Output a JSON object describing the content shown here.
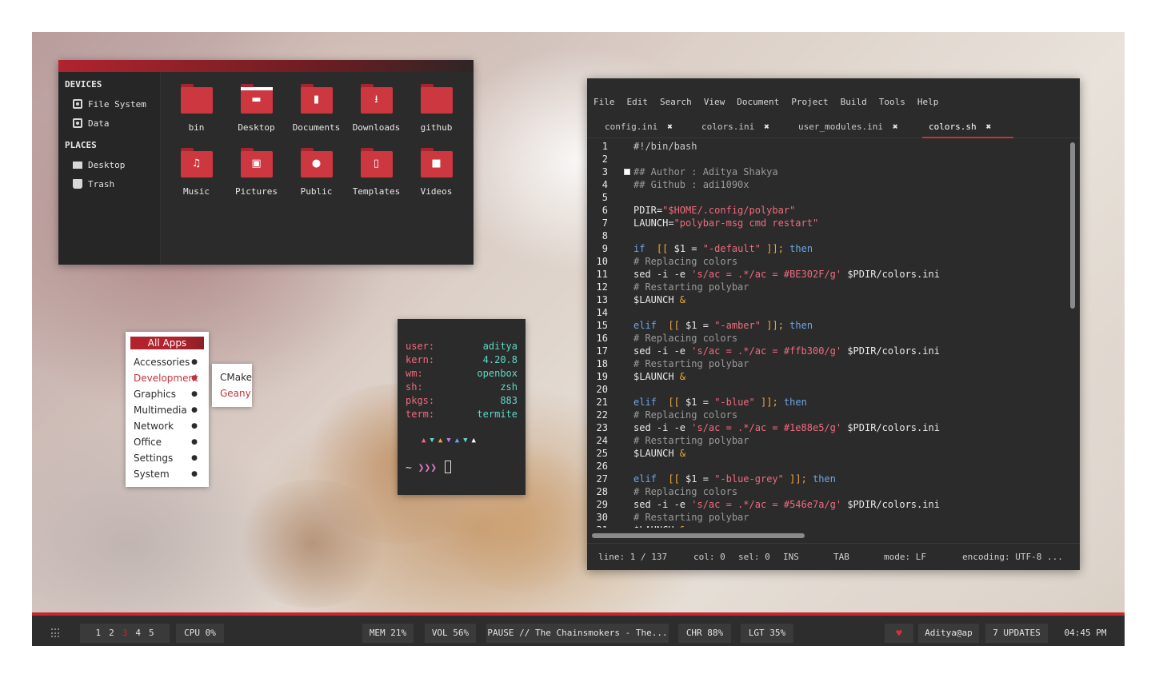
{
  "file_manager": {
    "sections": [
      {
        "title": "DEVICES",
        "items": [
          {
            "label": "File System",
            "icon": "disk-icon"
          },
          {
            "label": "Data",
            "icon": "disk-icon"
          }
        ]
      },
      {
        "title": "PLACES",
        "items": [
          {
            "label": "Desktop",
            "icon": "desktop-icon"
          },
          {
            "label": "Trash",
            "icon": "trash-icon"
          }
        ]
      }
    ],
    "folders": [
      {
        "label": "bin",
        "icon": "folder-icon"
      },
      {
        "label": "Desktop",
        "icon": "folder-desktop-icon"
      },
      {
        "label": "Documents",
        "icon": "folder-documents-icon"
      },
      {
        "label": "Downloads",
        "icon": "folder-downloads-icon"
      },
      {
        "label": "github",
        "icon": "folder-icon"
      },
      {
        "label": "Music",
        "icon": "folder-music-icon"
      },
      {
        "label": "Pictures",
        "icon": "folder-pictures-icon"
      },
      {
        "label": "Public",
        "icon": "folder-public-icon"
      },
      {
        "label": "Templates",
        "icon": "folder-templates-icon"
      },
      {
        "label": "Videos",
        "icon": "folder-videos-icon"
      }
    ]
  },
  "menu": {
    "title": "All Apps",
    "items": [
      "Accessories",
      "Development",
      "Graphics",
      "Multimedia",
      "Network",
      "Office",
      "Settings",
      "System"
    ],
    "active": "Development",
    "submenu": [
      "CMake",
      "Geany"
    ]
  },
  "terminal": {
    "rows": [
      {
        "key": "user:",
        "value": "aditya"
      },
      {
        "key": "kern:",
        "value": "4.20.8"
      },
      {
        "key": "wm:",
        "value": "openbox"
      },
      {
        "key": "sh:",
        "value": "zsh"
      },
      {
        "key": "pkgs:",
        "value": "883"
      },
      {
        "key": "term:",
        "value": "termite"
      }
    ],
    "triangles": "▲▼▲▼▲▼▲",
    "prompt_tilde": "~",
    "prompt_arrows": "❯❯❯"
  },
  "editor": {
    "menu": [
      "File",
      "Edit",
      "Search",
      "View",
      "Document",
      "Project",
      "Build",
      "Tools",
      "Help"
    ],
    "tabs": [
      {
        "label": "config.ini",
        "close": "✖"
      },
      {
        "label": "colors.ini",
        "close": "✖"
      },
      {
        "label": "user_modules.ini",
        "close": "✖"
      },
      {
        "label": "colors.sh",
        "close": "✖"
      }
    ],
    "active_tab": "colors.sh",
    "lines": [
      "#!/bin/bash",
      "",
      "## Author : Aditya Shakya",
      "## Github : adi1090x",
      "",
      "PDIR=\"$HOME/.config/polybar\"",
      "LAUNCH=\"polybar-msg cmd restart\"",
      "",
      "if  [[ $1 = \"-default\" ]]; then",
      "# Replacing colors",
      "sed -i -e 's/ac = .*/ac = #BE302F/g' $PDIR/colors.ini",
      "# Restarting polybar",
      "$LAUNCH &",
      "",
      "elif  [[ $1 = \"-amber\" ]]; then",
      "# Replacing colors",
      "sed -i -e 's/ac = .*/ac = #ffb300/g' $PDIR/colors.ini",
      "# Restarting polybar",
      "$LAUNCH &",
      "",
      "elif  [[ $1 = \"-blue\" ]]; then",
      "# Replacing colors",
      "sed -i -e 's/ac = .*/ac = #1e88e5/g' $PDIR/colors.ini",
      "# Restarting polybar",
      "$LAUNCH &",
      "",
      "elif  [[ $1 = \"-blue-grey\" ]]; then",
      "# Replacing colors",
      "sed -i -e 's/ac = .*/ac = #546e7a/g' $PDIR/colors.ini",
      "# Restarting polybar",
      "$LAUNCH &"
    ],
    "status": {
      "line": "line: 1 / 137",
      "col": "col: 0",
      "sel": "sel: 0",
      "ins": "INS",
      "tab": "TAB",
      "mode": "mode: LF",
      "encoding": "encoding: UTF-8 ..."
    }
  },
  "polybar": {
    "workspaces": [
      "1",
      "2",
      "3",
      "4",
      "5"
    ],
    "active_workspace": "3",
    "cpu": "CPU 0%",
    "mem": "MEM 21%",
    "vol": "VOL 56%",
    "music": "PAUSE // The Chainsmokers - The...",
    "chr": "CHR 88%",
    "lgt": "LGT 35%",
    "heart": "♥",
    "user": "Aditya@ap",
    "updates": "7 UPDATES",
    "time": "04:45 PM"
  },
  "colors": {
    "accent": "#c8262f",
    "terminal_key": "#f06b7d",
    "terminal_value": "#5fd7c7",
    "editor_bg": "#2b2b2b"
  }
}
